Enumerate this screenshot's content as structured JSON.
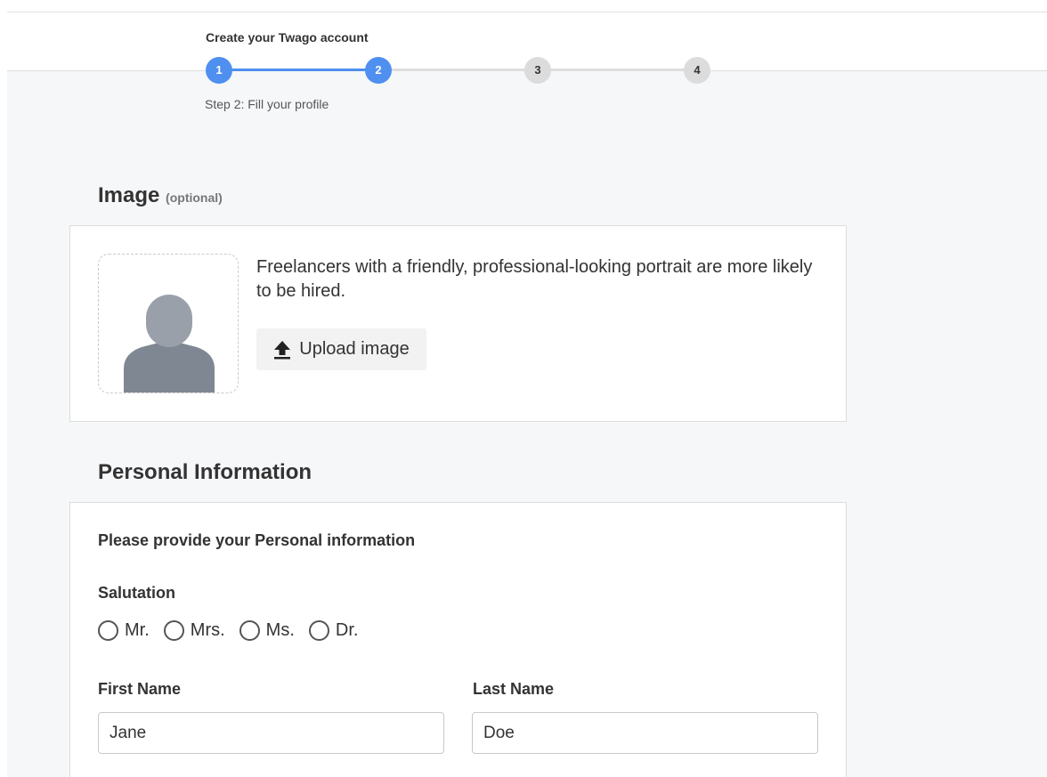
{
  "wizard": {
    "title": "Create your Twago account",
    "steps": [
      "1",
      "2",
      "3",
      "4"
    ],
    "current_step": 2,
    "caption": "Step  2:  Fill your profile"
  },
  "image_section": {
    "title": "Image",
    "optional_note": "(optional)",
    "hint": "Freelancers with a friendly, professional-looking portrait are more likely to be hired.",
    "upload_label": "Upload image",
    "icons": {
      "upload": "upload-arrow-icon",
      "avatar": "person-silhouette-icon"
    }
  },
  "personal_section": {
    "title": "Personal Information",
    "intro": "Please provide your Personal information",
    "salutation_label": "Salutation",
    "salutation_options": [
      "Mr.",
      "Mrs.",
      "Ms.",
      "Dr."
    ],
    "first_name_label": "First Name",
    "first_name_value": "Jane",
    "last_name_label": "Last Name",
    "last_name_value": "Doe"
  },
  "colors": {
    "accent": "#4e8ff0",
    "inactive_step": "#dcdcdc",
    "page_background": "#f6f7f9",
    "avatar": "#7f8792"
  }
}
